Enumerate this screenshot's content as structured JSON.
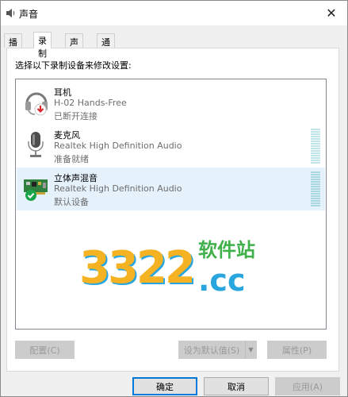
{
  "window": {
    "title": "声音",
    "close_glyph": "✕"
  },
  "tabs": [
    {
      "label": "播放",
      "active": false
    },
    {
      "label": "录制",
      "active": true
    },
    {
      "label": "声音",
      "active": false
    },
    {
      "label": "通信",
      "active": false
    }
  ],
  "panel": {
    "instruction": "选择以下录制设备来修改设置:",
    "devices": [
      {
        "name": "耳机",
        "driver": "H-02 Hands-Free",
        "status": "已断开连接",
        "icon": "headset-disconnected-icon",
        "selected": false
      },
      {
        "name": "麦克风",
        "driver": "Realtek High Definition Audio",
        "status": "准备就绪",
        "icon": "microphone-icon",
        "selected": false
      },
      {
        "name": "立体声混音",
        "driver": "Realtek High Definition Audio",
        "status": "默认设备",
        "icon": "sound-card-default-icon",
        "selected": true
      }
    ],
    "watermark": {
      "digits": "3322",
      "chinese": "软件站",
      "suffix": ".cc"
    },
    "buttons": {
      "configure": "配置(C)",
      "set_default": "设为默认值(S)",
      "properties": "属性(P)"
    }
  },
  "footer": {
    "ok": "确定",
    "cancel": "取消",
    "apply": "应用(A)"
  },
  "colors": {
    "accent": "#0078d7",
    "selection": "#e5f1fb",
    "default_check": "#1aa54a",
    "disconnect_arrow": "#d9262c"
  }
}
